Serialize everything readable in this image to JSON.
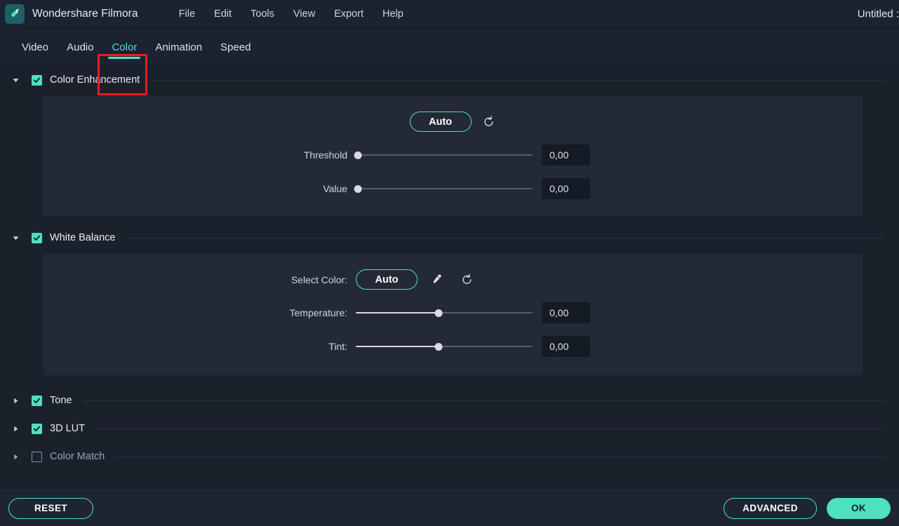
{
  "titlebar": {
    "app_name": "Wondershare Filmora",
    "logo_icon": "filmora-logo-icon",
    "menu": [
      {
        "label": "File"
      },
      {
        "label": "Edit"
      },
      {
        "label": "Tools"
      },
      {
        "label": "View"
      },
      {
        "label": "Export"
      },
      {
        "label": "Help"
      }
    ],
    "document_title": "Untitled : "
  },
  "tabs": [
    {
      "label": "Video",
      "active": false
    },
    {
      "label": "Audio",
      "active": false
    },
    {
      "label": "Color",
      "active": true
    },
    {
      "label": "Animation",
      "active": false
    },
    {
      "label": "Speed",
      "active": false
    }
  ],
  "annotation": {
    "type": "highlight-box",
    "target": "Color",
    "color": "#f21b1b"
  },
  "colors": {
    "accent": "#4fe0bf",
    "page_bg": "#1b212b",
    "card_bg": "#232935",
    "chrome_bg": "#1b2230",
    "footer_bg": "#1e2532",
    "input_bg": "#151b24",
    "highlight_red": "#f21b1b"
  },
  "sections": [
    {
      "id": "color-enhancement",
      "label": "Color Enhancement",
      "checked": true,
      "expanded": true,
      "auto_label": "Auto",
      "reset_icon": "reset-icon",
      "sliders": [
        {
          "label": "Threshold",
          "value": "0,00",
          "position_pct": 1
        },
        {
          "label": "Value",
          "value": "0,00",
          "position_pct": 1
        }
      ]
    },
    {
      "id": "white-balance",
      "label": "White Balance",
      "checked": true,
      "expanded": true,
      "select_color_label": "Select Color:",
      "auto_label": "Auto",
      "eyedropper_icon": "eyedropper-icon",
      "reset_icon": "reset-icon",
      "sliders": [
        {
          "label": "Temperature:",
          "value": "0,00",
          "position_pct": 47
        },
        {
          "label": "Tint:",
          "value": "0,00",
          "position_pct": 47
        }
      ]
    },
    {
      "id": "tone",
      "label": "Tone",
      "checked": true,
      "expanded": false
    },
    {
      "id": "3d-lut",
      "label": "3D LUT",
      "checked": true,
      "expanded": false
    },
    {
      "id": "color-match",
      "label": "Color Match",
      "checked": false,
      "expanded": false
    }
  ],
  "footer": {
    "reset_label": "RESET",
    "advanced_label": "ADVANCED",
    "ok_label": "OK"
  }
}
